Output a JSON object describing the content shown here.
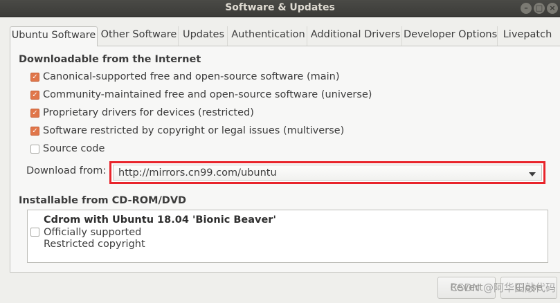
{
  "window": {
    "title": "Software & Updates",
    "controls": [
      "minimize",
      "maximize",
      "close"
    ]
  },
  "tabs": [
    {
      "label": "Ubuntu Software",
      "active": true
    },
    {
      "label": "Other Software",
      "active": false
    },
    {
      "label": "Updates",
      "active": false
    },
    {
      "label": "Authentication",
      "active": false
    },
    {
      "label": "Additional Drivers",
      "active": false
    },
    {
      "label": "Developer Options",
      "active": false
    },
    {
      "label": "Livepatch",
      "active": false
    }
  ],
  "downloadable": {
    "heading": "Downloadable from the Internet",
    "items": [
      {
        "label": "Canonical-supported free and open-source software (main)",
        "checked": true
      },
      {
        "label": "Community-maintained free and open-source software (universe)",
        "checked": true
      },
      {
        "label": "Proprietary drivers for devices (restricted)",
        "checked": true
      },
      {
        "label": "Software restricted by copyright or legal issues (multiverse)",
        "checked": true
      },
      {
        "label": "Source code",
        "checked": false
      }
    ],
    "download_from_label": "Download from:",
    "download_from_value": "http://mirrors.cn99.com/ubuntu"
  },
  "cdrom": {
    "heading": "Installable from CD-ROM/DVD",
    "item_title": "Cdrom with Ubuntu 18.04 'Bionic Beaver'",
    "item_lines": [
      "Officially supported",
      "Restricted copyright"
    ],
    "checked": false
  },
  "buttons": {
    "revert": "Revert",
    "close": "Close"
  },
  "watermark": "CSDN @阿华田敲代码",
  "colors": {
    "accent": "#e0764a",
    "highlight_border": "#e8242b",
    "titlebar": "#3b3b38"
  }
}
